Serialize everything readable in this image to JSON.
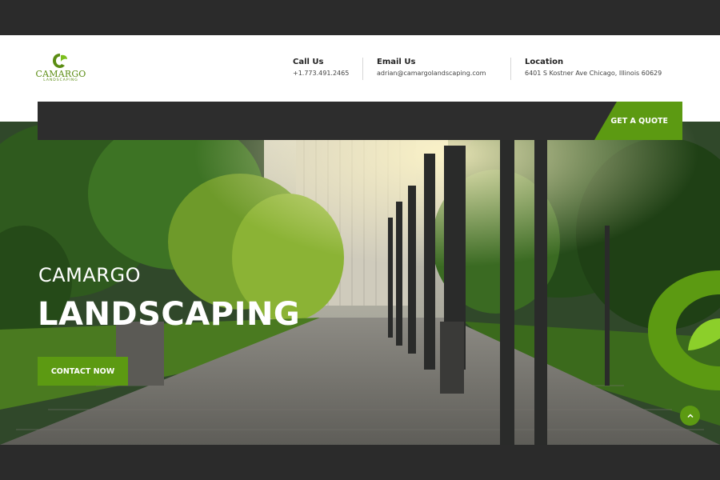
{
  "brand": {
    "name": "CAMARGO",
    "tagline": "LANDSCAPING"
  },
  "header": {
    "call": {
      "label": "Call Us",
      "value": "+1.773.491.2465"
    },
    "email": {
      "label": "Email Us",
      "value": "adrian@camargolandscaping.com"
    },
    "location": {
      "label": "Location",
      "value": "6401 S Kostner Ave Chicago, Illinois 60629"
    }
  },
  "nav": {
    "quote_label": "GET A QUOTE"
  },
  "hero": {
    "title_small": "CAMARGO",
    "title_large": "LANDSCAPING",
    "cta_label": "CONTACT NOW"
  },
  "icons": {
    "logo": "leaf-c-logo-icon",
    "scroll_top": "chevron-up-icon"
  },
  "colors": {
    "accent": "#5c9a12",
    "dark": "#2d2d2d"
  }
}
